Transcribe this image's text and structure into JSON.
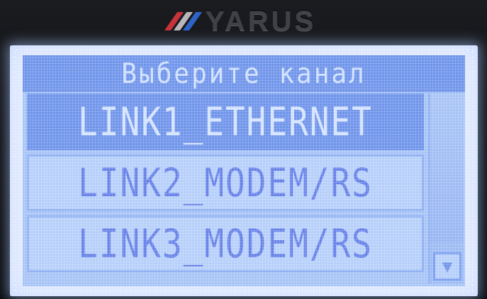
{
  "device": {
    "brand": "YARUS",
    "stripe_colors": [
      "#c8323a",
      "#b8b8bc",
      "#2f63c8"
    ]
  },
  "screen": {
    "title": "Выберите канал",
    "items": [
      {
        "label": "LINK1_ETHERNET",
        "selected": true
      },
      {
        "label": "LINK2_MODEM/RS",
        "selected": false
      },
      {
        "label": "LINK3_MODEM/RS",
        "selected": false
      }
    ],
    "scroll_down_icon": "triangle-down-icon"
  },
  "colors": {
    "lcd_background": "#a7c4f6",
    "highlight": "#6f94ea",
    "text": "#6680e8"
  }
}
